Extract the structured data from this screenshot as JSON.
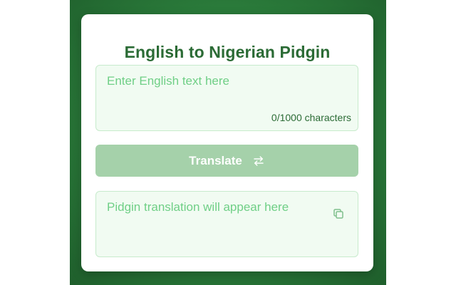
{
  "app": {
    "title": "English to Nigerian Pidgin"
  },
  "input": {
    "placeholder": "Enter English text here",
    "char_count": "0/1000 characters"
  },
  "translate_button": {
    "label": "Translate",
    "icon": "swap-arrows-icon"
  },
  "output": {
    "placeholder": "Pidgin translation will appear here",
    "copy_icon": "copy-icon"
  },
  "colors": {
    "background": "#2a7a3a",
    "title": "#2b6b35",
    "field_bg": "#f1fbf2",
    "placeholder": "#6fcf86",
    "button_disabled": "#a5d1aa"
  }
}
